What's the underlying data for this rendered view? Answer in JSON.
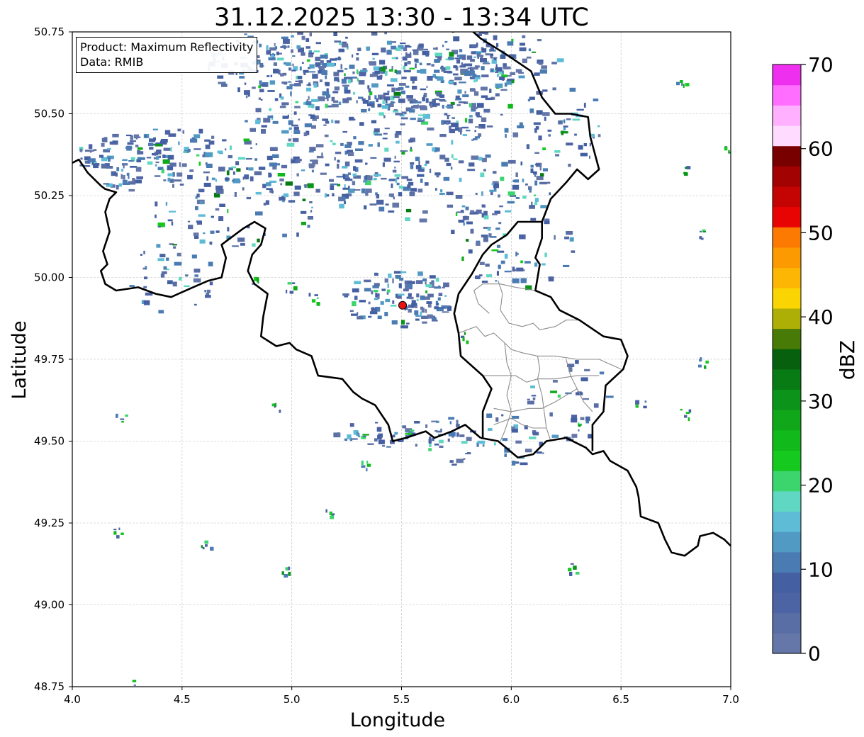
{
  "title": "31.12.2025 13:30 - 13:34 UTC",
  "info_box": {
    "product": "Product: Maximum Reflectivity",
    "data_source": "Data: RMIB"
  },
  "axes": {
    "xlabel": "Longitude",
    "ylabel": "Latitude",
    "xlim": [
      4.0,
      7.0
    ],
    "ylim": [
      48.75,
      50.75
    ],
    "xticks": [
      "4.0",
      "4.5",
      "5.0",
      "5.5",
      "6.0",
      "6.5",
      "7.0"
    ],
    "yticks": [
      "50.75",
      "50.50",
      "50.25",
      "50.00",
      "49.75",
      "49.50",
      "49.25",
      "49.00",
      "48.75"
    ],
    "grid": true
  },
  "colorbar": {
    "label": "dBZ",
    "ticks": [
      "0",
      "10",
      "20",
      "30",
      "40",
      "50",
      "60",
      "70"
    ],
    "range": [
      0,
      70
    ],
    "colors": [
      "#6577a8",
      "#5a6ea6",
      "#4d64a4",
      "#4460a3",
      "#4a7bb3",
      "#519ac4",
      "#5fbcd7",
      "#5fd7c2",
      "#3cd46d",
      "#16c91e",
      "#12b91a",
      "#10a71a",
      "#0c941a",
      "#097b14",
      "#06600e",
      "#477a06",
      "#adae06",
      "#fbd503",
      "#fcb603",
      "#fc9a02",
      "#fc7a02",
      "#e90404",
      "#c40303",
      "#a20202",
      "#780100",
      "#ffdcff",
      "#ffb0ff",
      "#ff6eff",
      "#ef2fef"
    ]
  },
  "radar_site": {
    "lon": 5.505,
    "lat": 49.915,
    "color": "#e81414"
  },
  "colors": {
    "border": "#000000",
    "region_lines": "#8c8c8c",
    "grid": "#bbbbbb"
  }
}
